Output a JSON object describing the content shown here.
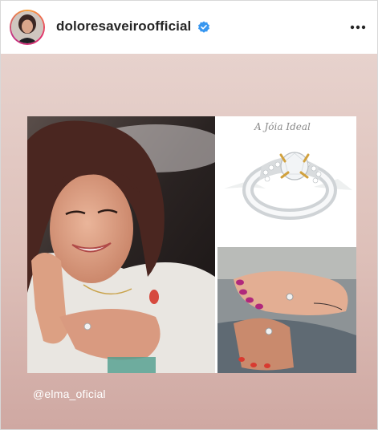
{
  "header": {
    "username": "doloresaveiroofficial",
    "verified_icon": "verified-badge-icon",
    "more_icon": "more-options-icon",
    "accent": "#3897f0"
  },
  "post": {
    "brand_text": "A Jóia Ideal",
    "mention": "@elma_oficial",
    "photos": [
      "woman-portrait",
      "diamond-ring-product",
      "hands-with-rings"
    ]
  }
}
